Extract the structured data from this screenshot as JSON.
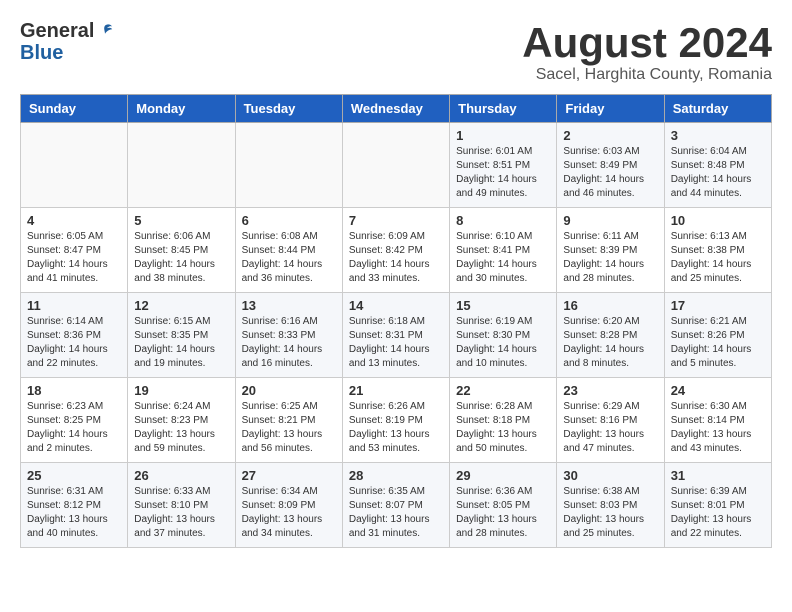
{
  "header": {
    "logo_line1": "General",
    "logo_line2": "Blue",
    "month_title": "August 2024",
    "subtitle": "Sacel, Harghita County, Romania"
  },
  "weekdays": [
    "Sunday",
    "Monday",
    "Tuesday",
    "Wednesday",
    "Thursday",
    "Friday",
    "Saturday"
  ],
  "weeks": [
    [
      {
        "day": "",
        "detail": ""
      },
      {
        "day": "",
        "detail": ""
      },
      {
        "day": "",
        "detail": ""
      },
      {
        "day": "",
        "detail": ""
      },
      {
        "day": "1",
        "detail": "Sunrise: 6:01 AM\nSunset: 8:51 PM\nDaylight: 14 hours\nand 49 minutes."
      },
      {
        "day": "2",
        "detail": "Sunrise: 6:03 AM\nSunset: 8:49 PM\nDaylight: 14 hours\nand 46 minutes."
      },
      {
        "day": "3",
        "detail": "Sunrise: 6:04 AM\nSunset: 8:48 PM\nDaylight: 14 hours\nand 44 minutes."
      }
    ],
    [
      {
        "day": "4",
        "detail": "Sunrise: 6:05 AM\nSunset: 8:47 PM\nDaylight: 14 hours\nand 41 minutes."
      },
      {
        "day": "5",
        "detail": "Sunrise: 6:06 AM\nSunset: 8:45 PM\nDaylight: 14 hours\nand 38 minutes."
      },
      {
        "day": "6",
        "detail": "Sunrise: 6:08 AM\nSunset: 8:44 PM\nDaylight: 14 hours\nand 36 minutes."
      },
      {
        "day": "7",
        "detail": "Sunrise: 6:09 AM\nSunset: 8:42 PM\nDaylight: 14 hours\nand 33 minutes."
      },
      {
        "day": "8",
        "detail": "Sunrise: 6:10 AM\nSunset: 8:41 PM\nDaylight: 14 hours\nand 30 minutes."
      },
      {
        "day": "9",
        "detail": "Sunrise: 6:11 AM\nSunset: 8:39 PM\nDaylight: 14 hours\nand 28 minutes."
      },
      {
        "day": "10",
        "detail": "Sunrise: 6:13 AM\nSunset: 8:38 PM\nDaylight: 14 hours\nand 25 minutes."
      }
    ],
    [
      {
        "day": "11",
        "detail": "Sunrise: 6:14 AM\nSunset: 8:36 PM\nDaylight: 14 hours\nand 22 minutes."
      },
      {
        "day": "12",
        "detail": "Sunrise: 6:15 AM\nSunset: 8:35 PM\nDaylight: 14 hours\nand 19 minutes."
      },
      {
        "day": "13",
        "detail": "Sunrise: 6:16 AM\nSunset: 8:33 PM\nDaylight: 14 hours\nand 16 minutes."
      },
      {
        "day": "14",
        "detail": "Sunrise: 6:18 AM\nSunset: 8:31 PM\nDaylight: 14 hours\nand 13 minutes."
      },
      {
        "day": "15",
        "detail": "Sunrise: 6:19 AM\nSunset: 8:30 PM\nDaylight: 14 hours\nand 10 minutes."
      },
      {
        "day": "16",
        "detail": "Sunrise: 6:20 AM\nSunset: 8:28 PM\nDaylight: 14 hours\nand 8 minutes."
      },
      {
        "day": "17",
        "detail": "Sunrise: 6:21 AM\nSunset: 8:26 PM\nDaylight: 14 hours\nand 5 minutes."
      }
    ],
    [
      {
        "day": "18",
        "detail": "Sunrise: 6:23 AM\nSunset: 8:25 PM\nDaylight: 14 hours\nand 2 minutes."
      },
      {
        "day": "19",
        "detail": "Sunrise: 6:24 AM\nSunset: 8:23 PM\nDaylight: 13 hours\nand 59 minutes."
      },
      {
        "day": "20",
        "detail": "Sunrise: 6:25 AM\nSunset: 8:21 PM\nDaylight: 13 hours\nand 56 minutes."
      },
      {
        "day": "21",
        "detail": "Sunrise: 6:26 AM\nSunset: 8:19 PM\nDaylight: 13 hours\nand 53 minutes."
      },
      {
        "day": "22",
        "detail": "Sunrise: 6:28 AM\nSunset: 8:18 PM\nDaylight: 13 hours\nand 50 minutes."
      },
      {
        "day": "23",
        "detail": "Sunrise: 6:29 AM\nSunset: 8:16 PM\nDaylight: 13 hours\nand 47 minutes."
      },
      {
        "day": "24",
        "detail": "Sunrise: 6:30 AM\nSunset: 8:14 PM\nDaylight: 13 hours\nand 43 minutes."
      }
    ],
    [
      {
        "day": "25",
        "detail": "Sunrise: 6:31 AM\nSunset: 8:12 PM\nDaylight: 13 hours\nand 40 minutes."
      },
      {
        "day": "26",
        "detail": "Sunrise: 6:33 AM\nSunset: 8:10 PM\nDaylight: 13 hours\nand 37 minutes."
      },
      {
        "day": "27",
        "detail": "Sunrise: 6:34 AM\nSunset: 8:09 PM\nDaylight: 13 hours\nand 34 minutes."
      },
      {
        "day": "28",
        "detail": "Sunrise: 6:35 AM\nSunset: 8:07 PM\nDaylight: 13 hours\nand 31 minutes."
      },
      {
        "day": "29",
        "detail": "Sunrise: 6:36 AM\nSunset: 8:05 PM\nDaylight: 13 hours\nand 28 minutes."
      },
      {
        "day": "30",
        "detail": "Sunrise: 6:38 AM\nSunset: 8:03 PM\nDaylight: 13 hours\nand 25 minutes."
      },
      {
        "day": "31",
        "detail": "Sunrise: 6:39 AM\nSunset: 8:01 PM\nDaylight: 13 hours\nand 22 minutes."
      }
    ]
  ]
}
